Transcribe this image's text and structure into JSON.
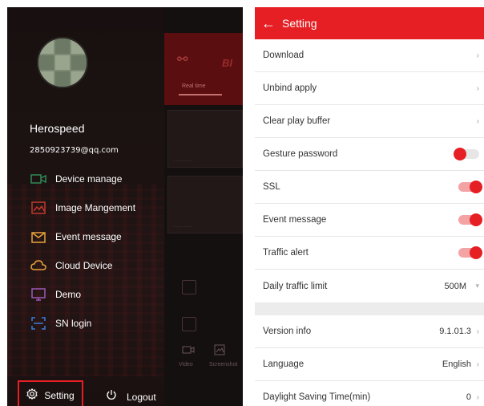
{
  "drawer": {
    "user_name": "Herospeed",
    "user_email": "2850923739@qq.com",
    "menu": [
      {
        "label": "Device manage",
        "icon": "camera-icon",
        "color": "#2e8b57"
      },
      {
        "label": "Image Mangement",
        "icon": "image-icon",
        "color": "#c0392b"
      },
      {
        "label": "Event message",
        "icon": "envelope-icon",
        "color": "#e6a23c"
      },
      {
        "label": "Cloud Device",
        "icon": "cloud-icon",
        "color": "#e6a23c"
      },
      {
        "label": "Demo",
        "icon": "monitor-icon",
        "color": "#9b59b6"
      },
      {
        "label": "SN login",
        "icon": "barcode-icon",
        "color": "#3b7dd8"
      }
    ],
    "setting_label": "Setting",
    "logout_label": "Logout",
    "background_app": {
      "brand": "BI",
      "tab": "Real time",
      "tab_video": "Video",
      "tab_screenshot": "Screenshot"
    }
  },
  "settings": {
    "title": "Setting",
    "accent_color": "#e51f24",
    "rows": [
      {
        "label": "Download",
        "type": "link"
      },
      {
        "label": "Unbind apply",
        "type": "link"
      },
      {
        "label": "Clear play buffer",
        "type": "link"
      },
      {
        "label": "Gesture password",
        "type": "toggle",
        "on": false
      },
      {
        "label": "SSL",
        "type": "toggle",
        "on": true
      },
      {
        "label": "Event message",
        "type": "toggle",
        "on": true
      },
      {
        "label": "Traffic alert",
        "type": "toggle",
        "on": true
      },
      {
        "label": "Daily traffic limit",
        "type": "select",
        "value": "500M"
      },
      {
        "label": "Version info",
        "type": "link",
        "value": "9.1.01.3"
      },
      {
        "label": "Language",
        "type": "link",
        "value": "English"
      },
      {
        "label": "Daylight Saving Time(min)",
        "type": "link",
        "value": "0"
      }
    ]
  }
}
